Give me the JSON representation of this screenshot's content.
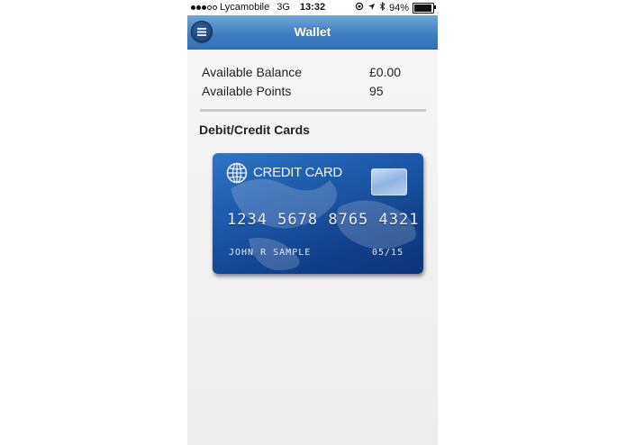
{
  "status_bar": {
    "carrier": "Lycamobile",
    "network": "3G",
    "time": "13:32",
    "battery_percent_label": "94%",
    "battery_level": 0.94,
    "signal_icons": [
      "signal-dots-icon"
    ],
    "right_icons": [
      "rotation-lock-icon",
      "location-arrow-icon",
      "bluetooth-icon",
      "battery-icon"
    ]
  },
  "header": {
    "title": "Wallet",
    "menu_icon": "menu-icon",
    "color": "#3d7cc0"
  },
  "balance": {
    "rows": [
      {
        "label": "Available Balance",
        "value": "£0.00"
      },
      {
        "label": "Available Points",
        "value": "95"
      }
    ]
  },
  "cards_section": {
    "title": "Debit/Credit Cards",
    "card": {
      "brand_label": "CREDIT CARD",
      "number": "1234 5678 8765 4321",
      "holder": "JOHN R SAMPLE",
      "expiry": "05/15",
      "icon": "globe-icon",
      "color": "#1c57a6"
    }
  }
}
